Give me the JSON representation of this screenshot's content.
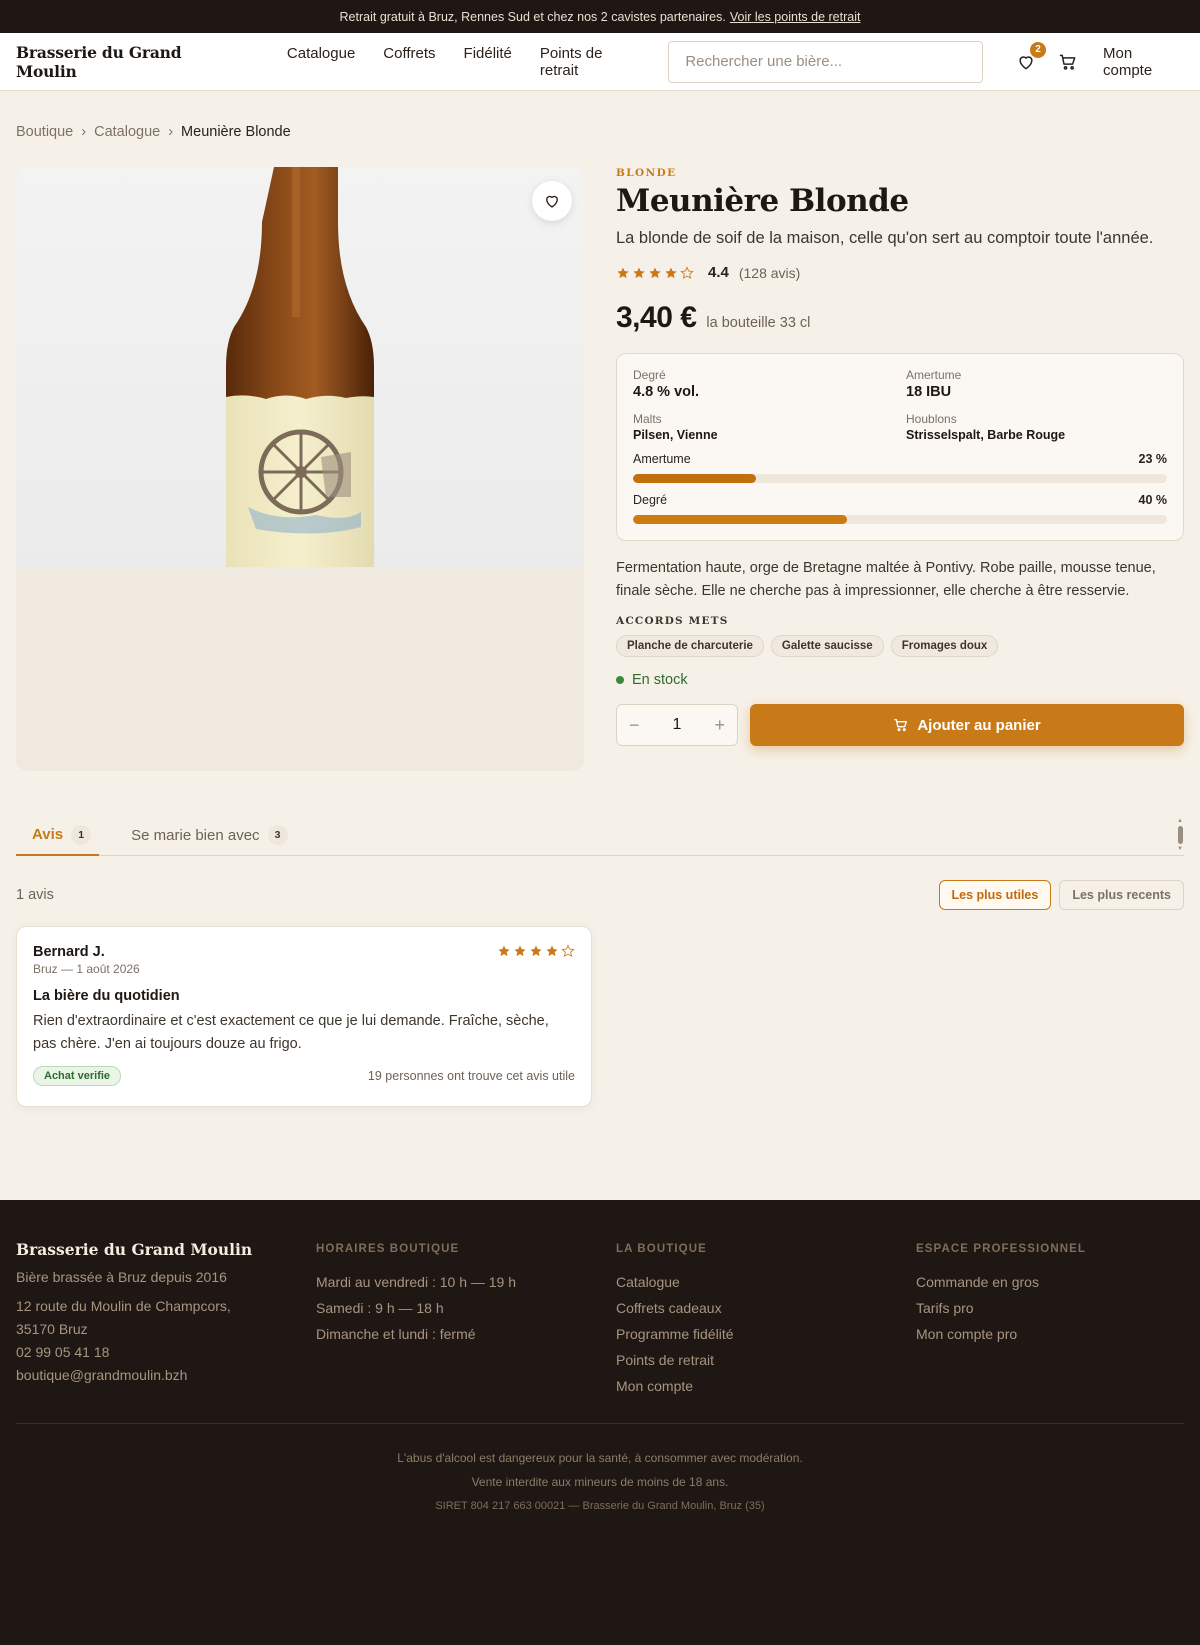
{
  "banner": {
    "text": "Retrait gratuit à Bruz, Rennes Sud et chez nos 2 cavistes partenaires.",
    "link": "Voir les points de retrait"
  },
  "header": {
    "logo": "Brasserie du Grand Moulin",
    "nav": [
      "Catalogue",
      "Coffrets",
      "Fidélité",
      "Points de retrait"
    ],
    "search_placeholder": "Rechercher une bière...",
    "wishlist_count": "2",
    "account": "Mon compte"
  },
  "breadcrumb": [
    "Boutique",
    "Catalogue",
    "Meunière Blonde"
  ],
  "product": {
    "category": "BLONDE",
    "name": "Meunière Blonde",
    "tagline": "La blonde de soif de la maison, celle qu'on sert au comptoir toute l'année.",
    "rating": "4.4",
    "rating_value": 4.4,
    "stars_filled": 4,
    "review_count": "(128 avis)",
    "price": "3,40 €",
    "unit": "la bouteille 33 cl",
    "specs": {
      "degree_label": "Degré",
      "degree": "4.8 % vol.",
      "bitterness_label": "Amertume",
      "bitterness": "18 IBU",
      "malts_label": "Malts",
      "malts": "Pilsen, Vienne",
      "hops_label": "Houblons",
      "hops": "Strisselspalt, Barbe Rouge"
    },
    "bars": [
      {
        "label": "Amertume",
        "pct_text": "23 %",
        "value": 0.23
      },
      {
        "label": "Degré",
        "pct_text": "40 %",
        "value": 0.4
      }
    ],
    "description": "Fermentation haute, orge de Bretagne maltée à Pontivy. Robe paille, mousse tenue, finale sèche. Elle ne cherche pas à impressionner, elle cherche à être resservie.",
    "pairings_title": "ACCORDS METS",
    "pairings": [
      "Planche de charcuterie",
      "Galette saucisse",
      "Fromages doux"
    ],
    "stock": "En stock",
    "quantity": "1",
    "add_to_cart": "Ajouter au panier"
  },
  "tabs": [
    {
      "label": "Avis",
      "count": "1",
      "active": true
    },
    {
      "label": "Se marie bien avec",
      "count": "3",
      "active": false
    }
  ],
  "reviews": {
    "count_text": "1 avis",
    "sort_options": [
      "Les plus utiles",
      "Les plus recents"
    ],
    "items": [
      {
        "author": "Bernard J.",
        "meta": "Bruz — 1 août 2026",
        "stars": 4,
        "title": "La bière du quotidien",
        "text": "Rien d'extraordinaire et c'est exactement ce que je lui demande. Fraîche, sèche, pas chère. J'en ai toujours douze au frigo.",
        "badge": "Achat verifie",
        "useful": "19 personnes ont trouve cet avis utile"
      }
    ]
  },
  "footer": {
    "logo": "Brasserie du Grand Moulin",
    "tagline": "Bière brassée à Bruz depuis 2016",
    "address_1": "12 route du Moulin de Champcors,",
    "address_2": "35170 Bruz",
    "phone": "02 99 05 41 18",
    "email": "boutique@grandmoulin.bzh",
    "hours_title": "HORAIRES BOUTIQUE",
    "hours": [
      "Mardi au vendredi : 10 h — 19 h",
      "Samedi : 9 h — 18 h",
      "Dimanche et lundi : fermé"
    ],
    "shop_title": "LA BOUTIQUE",
    "shop_links": [
      "Catalogue",
      "Coffrets cadeaux",
      "Programme fidélité",
      "Points de retrait",
      "Mon compte"
    ],
    "pro_title": "ESPACE PROFESSIONNEL",
    "pro_links": [
      "Commande en gros",
      "Tarifs pro",
      "Mon compte pro"
    ],
    "legal_1": "L'abus d'alcool est dangereux pour la santé, à consommer avec modération.",
    "legal_2": "Vente interdite aux mineurs de moins de 18 ans.",
    "siret": "SIRET 804 217 663 00021 — Brasserie du Grand Moulin, Bruz (35)"
  },
  "colors": {
    "accent": "#c97a18",
    "dark": "#1e1713",
    "background": "#f6f1e8",
    "success": "#3a8a3c"
  },
  "icons": [
    "heart-icon",
    "cart-icon",
    "star-icon",
    "plus-icon",
    "minus-icon"
  ]
}
